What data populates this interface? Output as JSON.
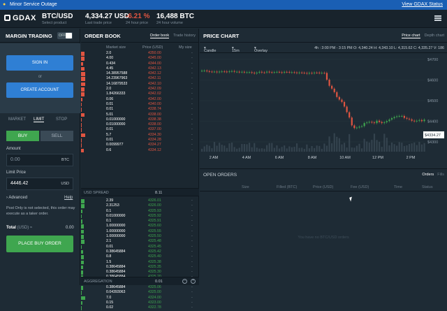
{
  "outage": {
    "text": "Minor Service Outage",
    "link": "View GDAX Status"
  },
  "app": {
    "logo": "GDAX"
  },
  "topbar": {
    "pair": "BTC/USD",
    "pair_sub": "Select product",
    "last_price": "4,334.27 USD",
    "last_price_sub": "Last trade price",
    "change": "-6.21 %",
    "change_sub": "24 hour price",
    "volume": "16,488 BTC",
    "volume_sub": "24 hour volume"
  },
  "margin": {
    "title": "MARGIN TRADING",
    "toggle": "OFF",
    "sign_in": "SIGN IN",
    "or": "or",
    "create": "CREATE ACCOUNT"
  },
  "order_form": {
    "tabs": [
      "MARKET",
      "LIMIT",
      "STOP"
    ],
    "buy": "BUY",
    "sell": "SELL",
    "amount_label": "Amount",
    "amount_value": "0.00",
    "amount_unit": "BTC",
    "limit_label": "Limit Price",
    "limit_value": "4446.42",
    "limit_unit": "USD",
    "advanced": "Advanced",
    "help": "Help",
    "note": "Post Only is not selected, this order may execute as a taker order.",
    "total_label": "Total",
    "total_unit": "(USD) ≈",
    "total_value": "0.00",
    "place": "PLACE BUY ORDER"
  },
  "order_book": {
    "title": "ORDER BOOK",
    "tab_on": "Order book",
    "tab_off": "Trade history",
    "col_size": "Market size",
    "col_price": "Price (USD)",
    "col_my": "My size",
    "asks": [
      [
        "2.0",
        "4350.00"
      ],
      [
        "4.00",
        "4345.00"
      ],
      [
        "0.434",
        "4344.00"
      ],
      [
        "4.45",
        "4342.13"
      ],
      [
        "14.38957588",
        "4342.12"
      ],
      [
        "14.23967963",
        "4342.11"
      ],
      [
        "14.16879533",
        "4342.10"
      ],
      [
        "2.0",
        "4342.09"
      ],
      [
        "1.84266333",
        "4342.02"
      ],
      [
        "0.06",
        "4342.00"
      ],
      [
        "0.01",
        "4340.00"
      ],
      [
        "0.01",
        "4338.74"
      ],
      [
        "5.01",
        "4338.00"
      ],
      [
        "0.01000000",
        "4338.38"
      ],
      [
        "0.01000000",
        "4338.00"
      ],
      [
        "0.01",
        "4337.00"
      ],
      [
        "5.7",
        "4334.30"
      ],
      [
        "0.01",
        "4334.28"
      ],
      [
        "0.0099977",
        "4334.27"
      ],
      [
        "0.6",
        "4334.12"
      ]
    ],
    "spread_label": "USD SPREAD",
    "spread_value": "8.11",
    "bids": [
      [
        "2.39",
        "4326.01"
      ],
      [
        "2.31253",
        "4326.00"
      ],
      [
        "0.1",
        "4325.93"
      ],
      [
        "0.01000000",
        "4325.92"
      ],
      [
        "0.1",
        "4325.91"
      ],
      [
        "1.00000000",
        "4325.60"
      ],
      [
        "1.00000000",
        "4325.55"
      ],
      [
        "1.00000000",
        "4325.50"
      ],
      [
        "2.1",
        "4325.48"
      ],
      [
        "0.01",
        "4325.45"
      ],
      [
        "0.38645884",
        "4325.42"
      ],
      [
        "0.8",
        "4325.40"
      ],
      [
        "1.5",
        "4325.38"
      ],
      [
        "0.38645884",
        "4325.35"
      ],
      [
        "0.38645884",
        "4325.30"
      ],
      [
        "0.38645884",
        "4325.20"
      ],
      [
        "0.38645884",
        "4325.15"
      ],
      [
        "0.38645884",
        "4325.06"
      ],
      [
        "0.04393063",
        "4325.00"
      ],
      [
        "7.0",
        "4324.00"
      ],
      [
        "0.15",
        "4323.00"
      ],
      [
        "0.02",
        "4322.78"
      ]
    ],
    "agg_label": "AGGREGATION",
    "agg_value": "0.01"
  },
  "price_chart": {
    "title": "PRICE CHART",
    "tab_on": "Price chart",
    "tab_off": "Depth chart",
    "type": "Candle",
    "interval": "15m",
    "overlay": "Overlay",
    "ohlc": "4h : 3:00 PM - 3:15 PM  O: 4,340.24  H: 4,343.10  L: 4,315.62  C: 4,335.27  V: 186",
    "y_ticks": [
      "$4700",
      "$4600",
      "$4500",
      "$4400",
      "$4300"
    ],
    "x_ticks": [
      "2 AM",
      "4 AM",
      "6 AM",
      "8 AM",
      "10 AM",
      "12 PM",
      "2 PM"
    ],
    "last_label": "$4334.27"
  },
  "open_orders": {
    "title": "OPEN ORDERS",
    "tab_on": "Orders",
    "tab_off": "Fills",
    "cols": [
      "Size",
      "Filled (BTC)",
      "Price (USD)",
      "Fee (USD)",
      "Time",
      "Status"
    ],
    "empty": "You have no BTC/USD orders"
  },
  "colors": {
    "ask": "#e05541",
    "bid": "#3fa64f",
    "accent": "#2f7fd4"
  }
}
